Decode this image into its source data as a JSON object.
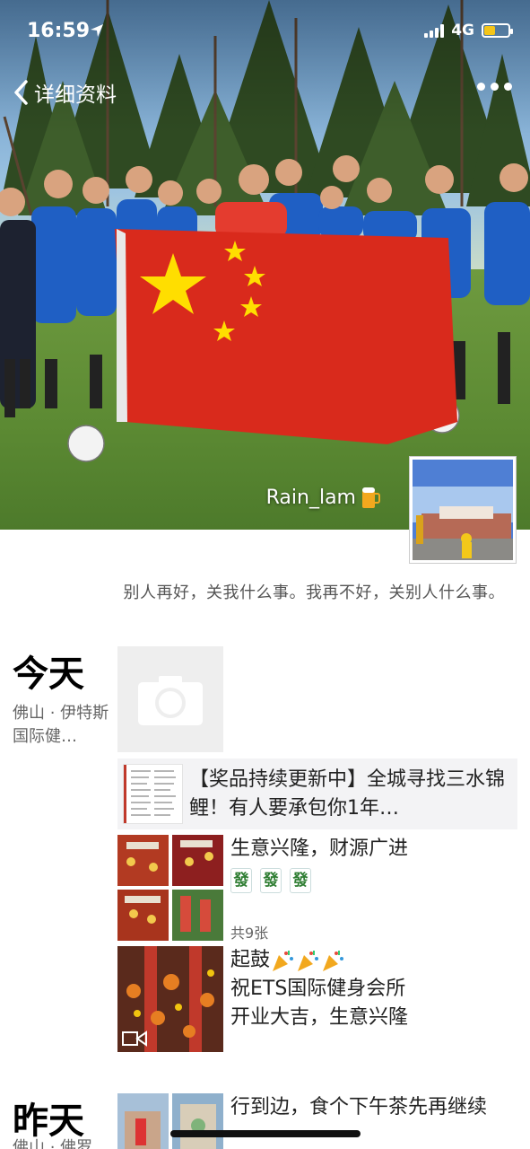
{
  "status_bar": {
    "time": "16:59",
    "network": "4G",
    "battery_level": 0.45
  },
  "nav": {
    "back_label": "详细资料"
  },
  "profile": {
    "nickname": "Rain_lam",
    "signature": "别人再好，关我什么事。我再不好，关别人什么事。"
  },
  "timeline": {
    "today": {
      "label": "今天",
      "location": "佛山 · 伊特斯国际健…",
      "link_post": {
        "text": "【奖品持续更新中】全城寻找三水锦鲤！有人要承包你1年…"
      },
      "photo_post": {
        "text": "生意兴隆，财源广进",
        "emoji": [
          "發",
          "發",
          "發"
        ],
        "count": "共9张"
      },
      "video_post": {
        "text_prefix": "起鼓",
        "text_lines": [
          "祝ETS国际健身会所",
          "开业大吉，生意兴隆"
        ]
      }
    },
    "yesterday": {
      "label": "昨天",
      "location": "佛山 · 佛罗",
      "post": {
        "text": "行到边，食个下午茶先再继续"
      }
    }
  },
  "colors": {
    "accent": "#f5c518",
    "flag_red": "#d92a1c",
    "flag_star": "#ffde00"
  }
}
